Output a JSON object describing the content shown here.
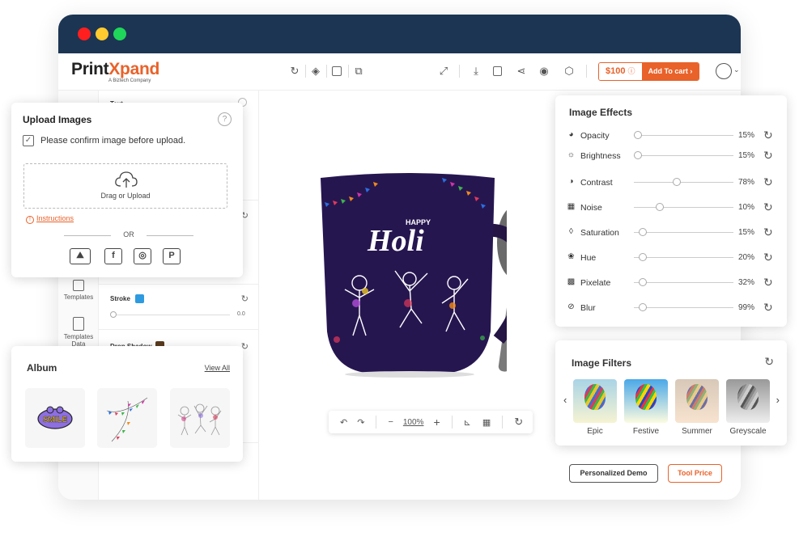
{
  "window": {
    "controls": [
      {
        "name": "close",
        "color": "#ff1f1f"
      },
      {
        "name": "minimize",
        "color": "#ffcb2f"
      },
      {
        "name": "maximize",
        "color": "#1fd65a"
      }
    ],
    "titlebar_color": "#1c3553"
  },
  "header": {
    "logo_main": "Print",
    "logo_accent": "Xpand",
    "logo_tagline": "A Biztech Company",
    "price": "$100",
    "price_info_icon": "info-icon",
    "add_to_cart": "Add To cart",
    "cart_chevron": "›",
    "accent_color": "#e8622a",
    "toolbar_left": [
      "history-icon",
      "layers-icon",
      "group-icon",
      "duplicate-icon"
    ],
    "toolbar_right": [
      "fullscreen-icon",
      "download-icon",
      "save-icon",
      "share-icon",
      "preview-icon",
      "3d-view-icon"
    ]
  },
  "rail": {
    "items": [
      {
        "label": "Templates"
      },
      {
        "label": "Templates Data"
      }
    ]
  },
  "props": {
    "text_label": "Text",
    "stroke_label": "Stroke",
    "stroke_color": "#2e9be0",
    "stroke_value": "0.0",
    "drop_shadow_label": "Drop Shadow",
    "drop_shadow_color": "#5a3a1e"
  },
  "upload": {
    "title": "Upload Images",
    "help": "?",
    "confirm_label": "Please confirm image before upload.",
    "confirm_checked": true,
    "drop_label": "Drag or Upload",
    "instructions": "Instructions",
    "or": "OR",
    "sources": [
      "gallery-icon",
      "facebook-icon",
      "instagram-icon",
      "pinterest-icon"
    ]
  },
  "album": {
    "title": "Album",
    "view_all": "View All",
    "items": [
      {
        "name": "smile-sticker"
      },
      {
        "name": "bunting-flags"
      },
      {
        "name": "holi-dancers"
      }
    ]
  },
  "canvas": {
    "mug_text_small": "HAPPY",
    "mug_text_large": "Holi",
    "zoom_level": "100%"
  },
  "effects": {
    "title": "Image Effects",
    "items": [
      {
        "label": "Opacity",
        "icon": "opacity-icon",
        "value": "15%",
        "fraction": 0.04
      },
      {
        "label": "Brightness",
        "icon": "brightness-icon",
        "value": "15%",
        "fraction": 0.04
      },
      {
        "label": "Contrast",
        "icon": "contrast-icon",
        "value": "78%",
        "fraction": 0.43
      },
      {
        "label": "Noise",
        "icon": "noise-icon",
        "value": "10%",
        "fraction": 0.26
      },
      {
        "label": "Saturation",
        "icon": "saturation-icon",
        "value": "15%",
        "fraction": 0.09
      },
      {
        "label": "Hue",
        "icon": "hue-icon",
        "value": "20%",
        "fraction": 0.09
      },
      {
        "label": "Pixelate",
        "icon": "pixelate-icon",
        "value": "32%",
        "fraction": 0.09
      },
      {
        "label": "Blur",
        "icon": "blur-icon",
        "value": "99%",
        "fraction": 0.09
      }
    ]
  },
  "filters": {
    "title": "Image Filters",
    "items": [
      {
        "label": "Epic"
      },
      {
        "label": "Festive"
      },
      {
        "label": "Summer"
      },
      {
        "label": "Greyscale"
      }
    ]
  },
  "footer": {
    "demo_button": "Personalized Demo",
    "price_button": "Tool Price"
  }
}
